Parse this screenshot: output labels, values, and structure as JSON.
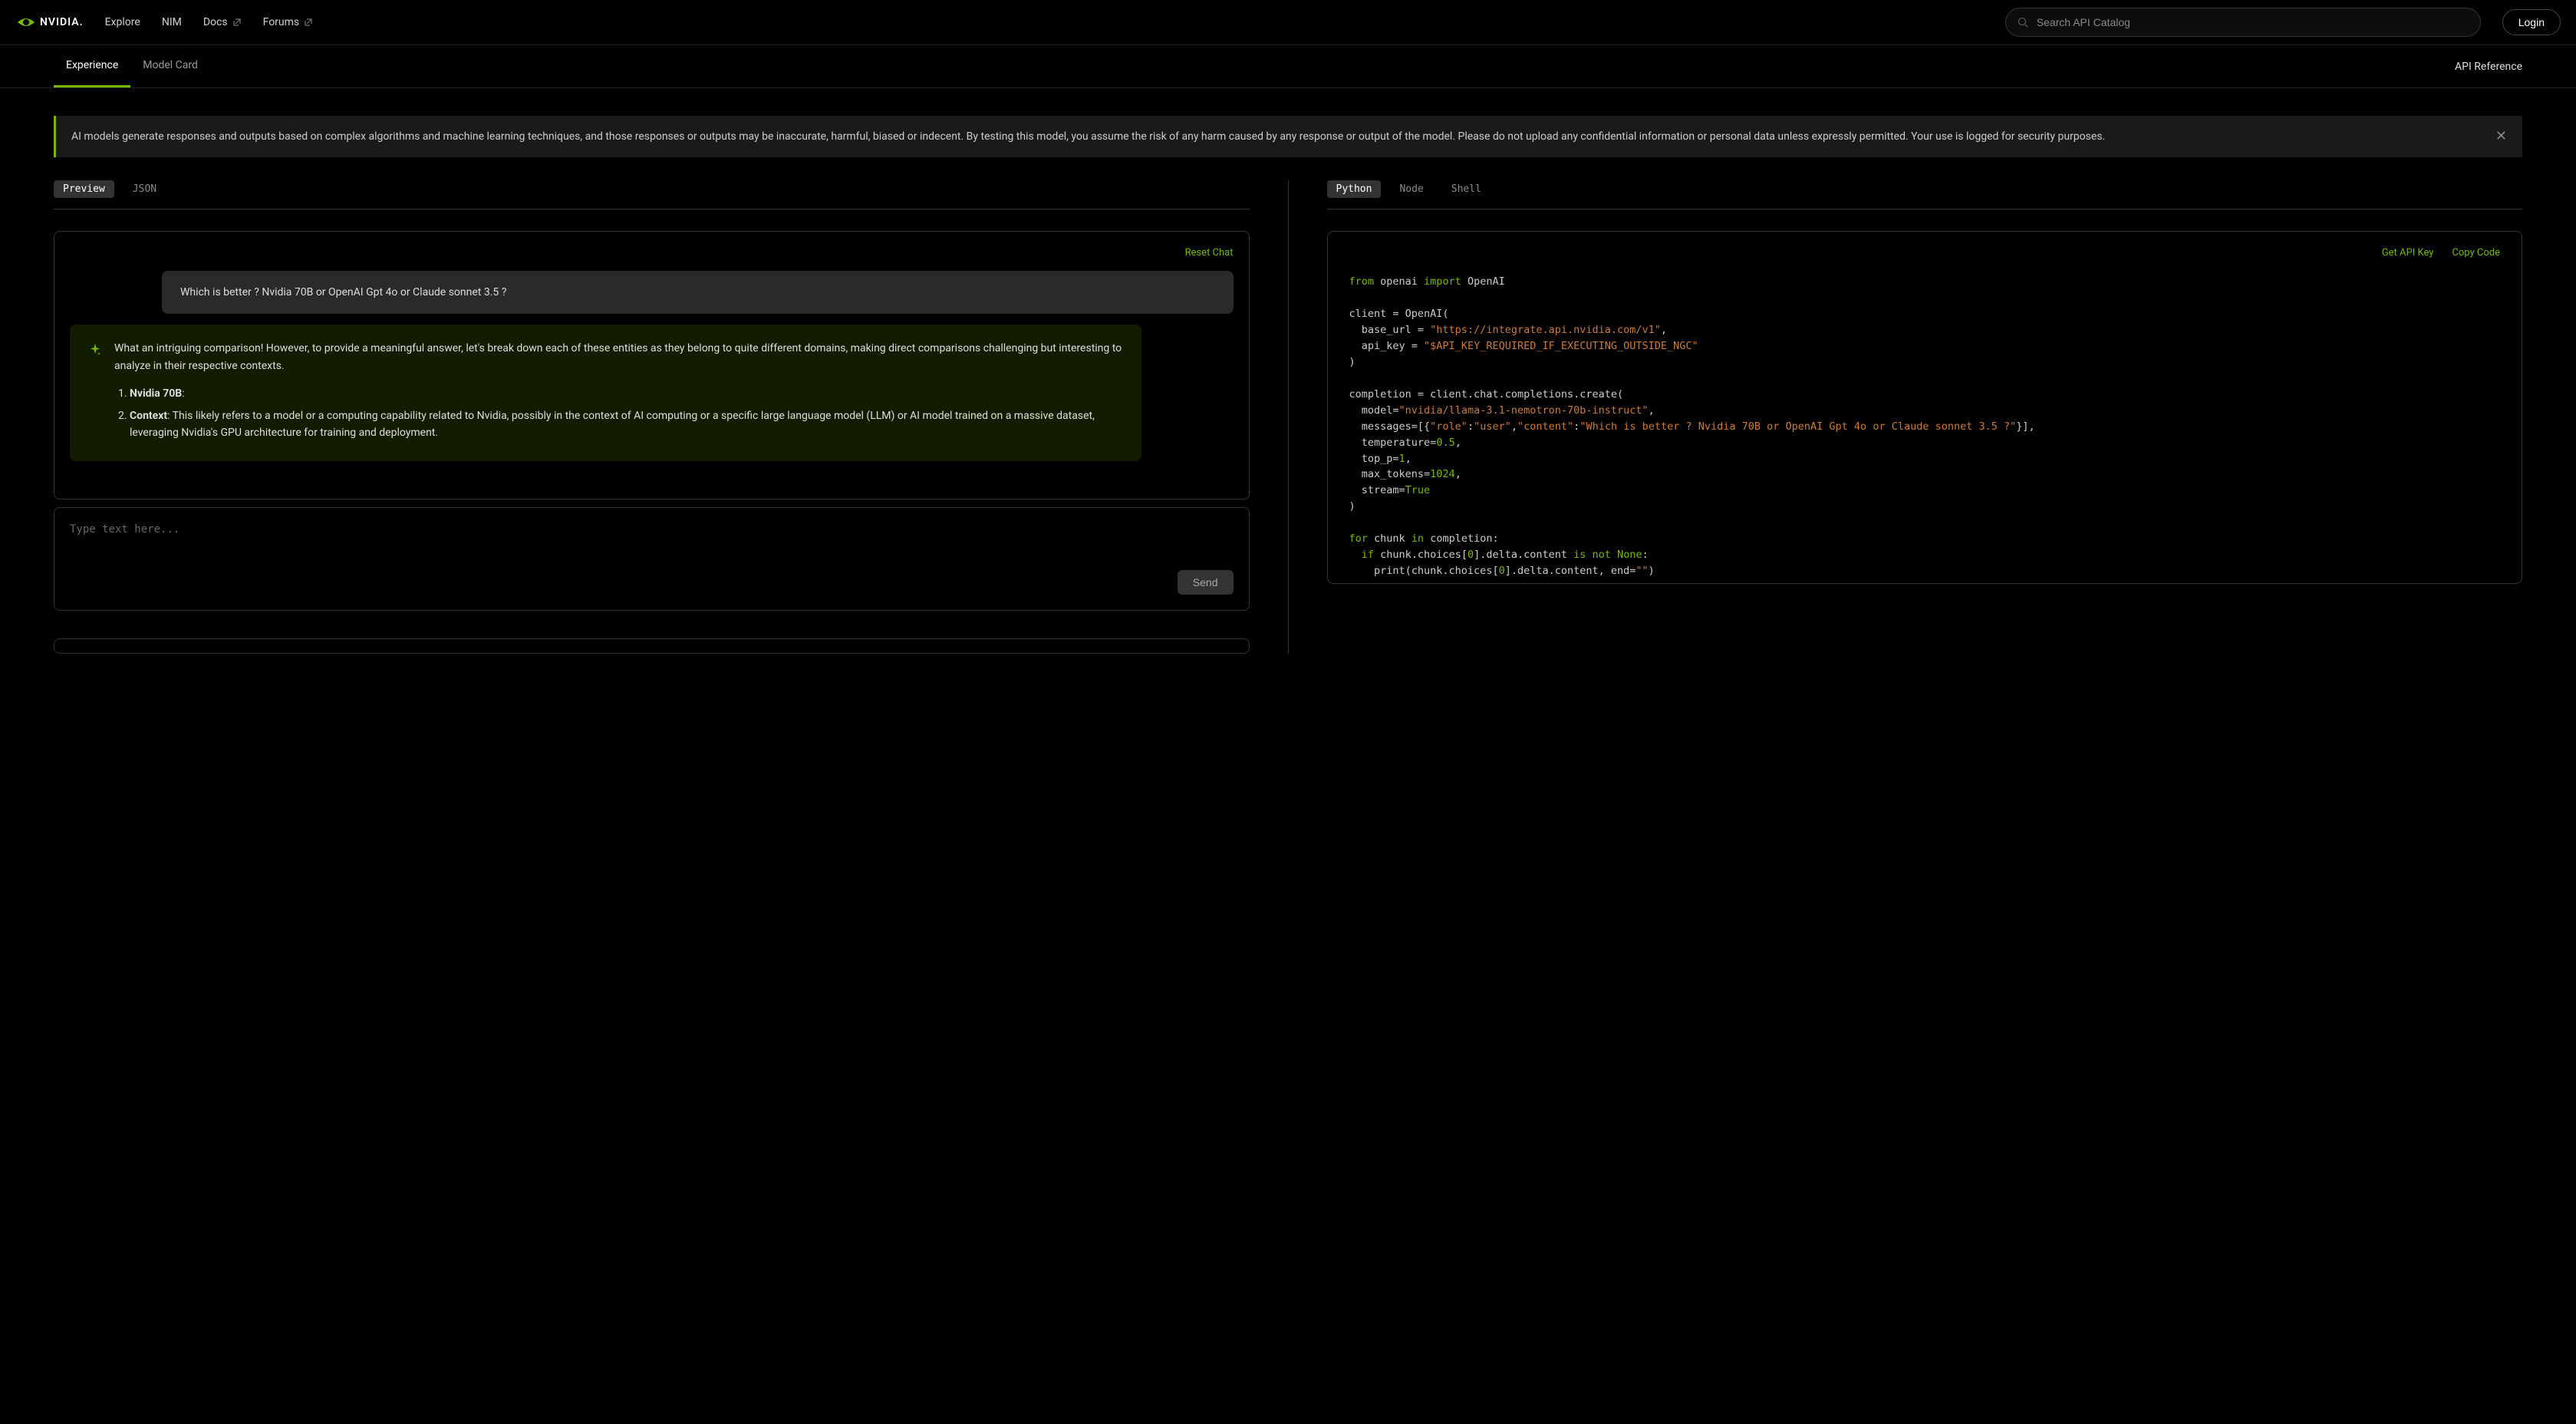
{
  "header": {
    "brand": "NVIDIA.",
    "nav": {
      "explore": "Explore",
      "nim": "NIM",
      "docs": "Docs",
      "forums": "Forums"
    },
    "search_placeholder": "Search API Catalog",
    "login": "Login"
  },
  "subnav": {
    "experience": "Experience",
    "model_card": "Model Card",
    "api_reference": "API Reference"
  },
  "alert": {
    "text": "AI models generate responses and outputs based on complex algorithms and machine learning techniques, and those responses or outputs may be inaccurate, harmful, biased or indecent. By testing this model, you assume the risk of any harm caused by any response or output of the model. Please do not upload any confidential information or personal data unless expressly permitted. Your use is logged for security purposes."
  },
  "left_tabs": {
    "preview": "Preview",
    "json": "JSON"
  },
  "right_tabs": {
    "python": "Python",
    "node": "Node",
    "shell": "Shell"
  },
  "chat": {
    "reset": "Reset Chat",
    "user_message": "Which is better ? Nvidia 70B or OpenAI Gpt 4o or Claude sonnet 3.5 ?",
    "assistant_intro": "What an intriguing comparison! However, to provide a meaningful answer, let's break down each of these entities as they belong to quite different domains, making direct comparisons challenging but interesting to analyze in their respective contexts.",
    "nvidia_label": "Nvidia 70B",
    "context_label": "Context",
    "context_text": ": This likely refers to a model or a computing capability related to Nvidia, possibly in the context of AI computing or a specific large language model (LLM) or AI model trained on a massive dataset, leveraging Nvidia's GPU architecture for training and deployment.",
    "input_placeholder": "Type text here...",
    "send": "Send"
  },
  "code_panel": {
    "get_api_key": "Get API Key",
    "copy_code": "Copy Code",
    "base_url": "\"https://integrate.api.nvidia.com/v1\"",
    "api_key": "\"$API_KEY_REQUIRED_IF_EXECUTING_OUTSIDE_NGC\"",
    "model": "\"nvidia/llama-3.1-nemotron-70b-instruct\"",
    "role": "\"role\"",
    "user": "\"user\"",
    "content_key": "\"content\"",
    "content_val": "\"Which is better ? Nvidia 70B or OpenAI Gpt 4o or Claude sonnet 3.5 ?\"",
    "temperature": "0.5",
    "top_p": "1",
    "max_tokens": "1024",
    "stream": "True",
    "zero": "0",
    "empty": "\"\""
  }
}
